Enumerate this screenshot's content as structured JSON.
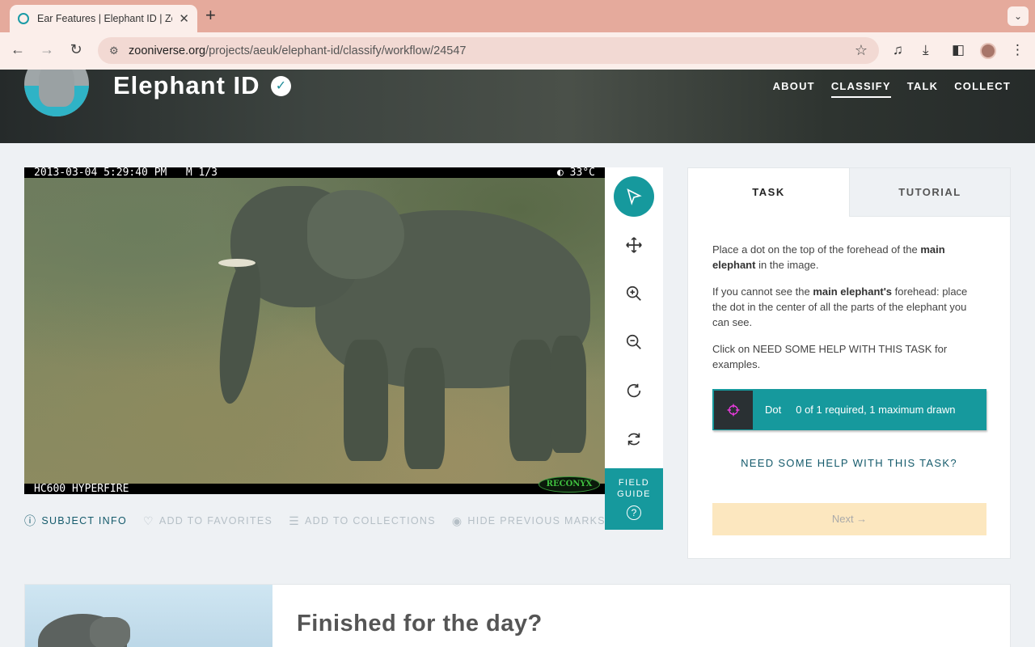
{
  "browser": {
    "tab_title": "Ear Features | Elephant ID | Zo",
    "new_tab": "+",
    "url_host": "zooniverse.org",
    "url_path": "/projects/aeuk/elephant-id/classify/workflow/24547"
  },
  "project": {
    "title": "Elephant ID",
    "nav": [
      "ABOUT",
      "CLASSIFY",
      "TALK",
      "COLLECT"
    ],
    "active_nav": "CLASSIFY"
  },
  "subject": {
    "cam_top": "2013-03-04 5:29:40 PM   M 1/3",
    "cam_temp": "◐  33°C",
    "cam_bottom": "HC600 HYPERFIRE",
    "logo": "RECONYX"
  },
  "tools": [
    "pointer-icon",
    "move-icon",
    "zoom-in-icon",
    "zoom-out-icon",
    "rotate-icon",
    "reset-icon"
  ],
  "field_guide": {
    "line1": "FIELD",
    "line2": "GUIDE",
    "q": "?"
  },
  "meta_actions": {
    "subject_info": "SUBJECT INFO",
    "favorites": "ADD TO FAVORITES",
    "collections": "ADD TO COLLECTIONS",
    "hide_marks": "HIDE PREVIOUS MARKS"
  },
  "task": {
    "tab_task": "TASK",
    "tab_tutorial": "TUTORIAL",
    "p1_a": "Place a dot on the top of the forehead of the ",
    "p1_b": "main elephant",
    "p1_c": " in the image.",
    "p2_a": "If you cannot see the ",
    "p2_b": "main elephant's",
    "p2_c": " forehead: place the dot in the center of all the parts of the elephant you can see.",
    "p3": "Click on NEED SOME HELP WITH THIS TASK for examples.",
    "tool_label": "Dot",
    "tool_count": "0 of 1 required, 1 maximum drawn",
    "help": "NEED SOME HELP WITH THIS TASK?",
    "next": "Next →"
  },
  "finished": {
    "title": "Finished for the day?"
  },
  "colors": {
    "teal": "#16999d",
    "dark_teal": "#145a6b",
    "tab_bar": "#e5aa9c",
    "next_disabled": "#fce7bf"
  }
}
